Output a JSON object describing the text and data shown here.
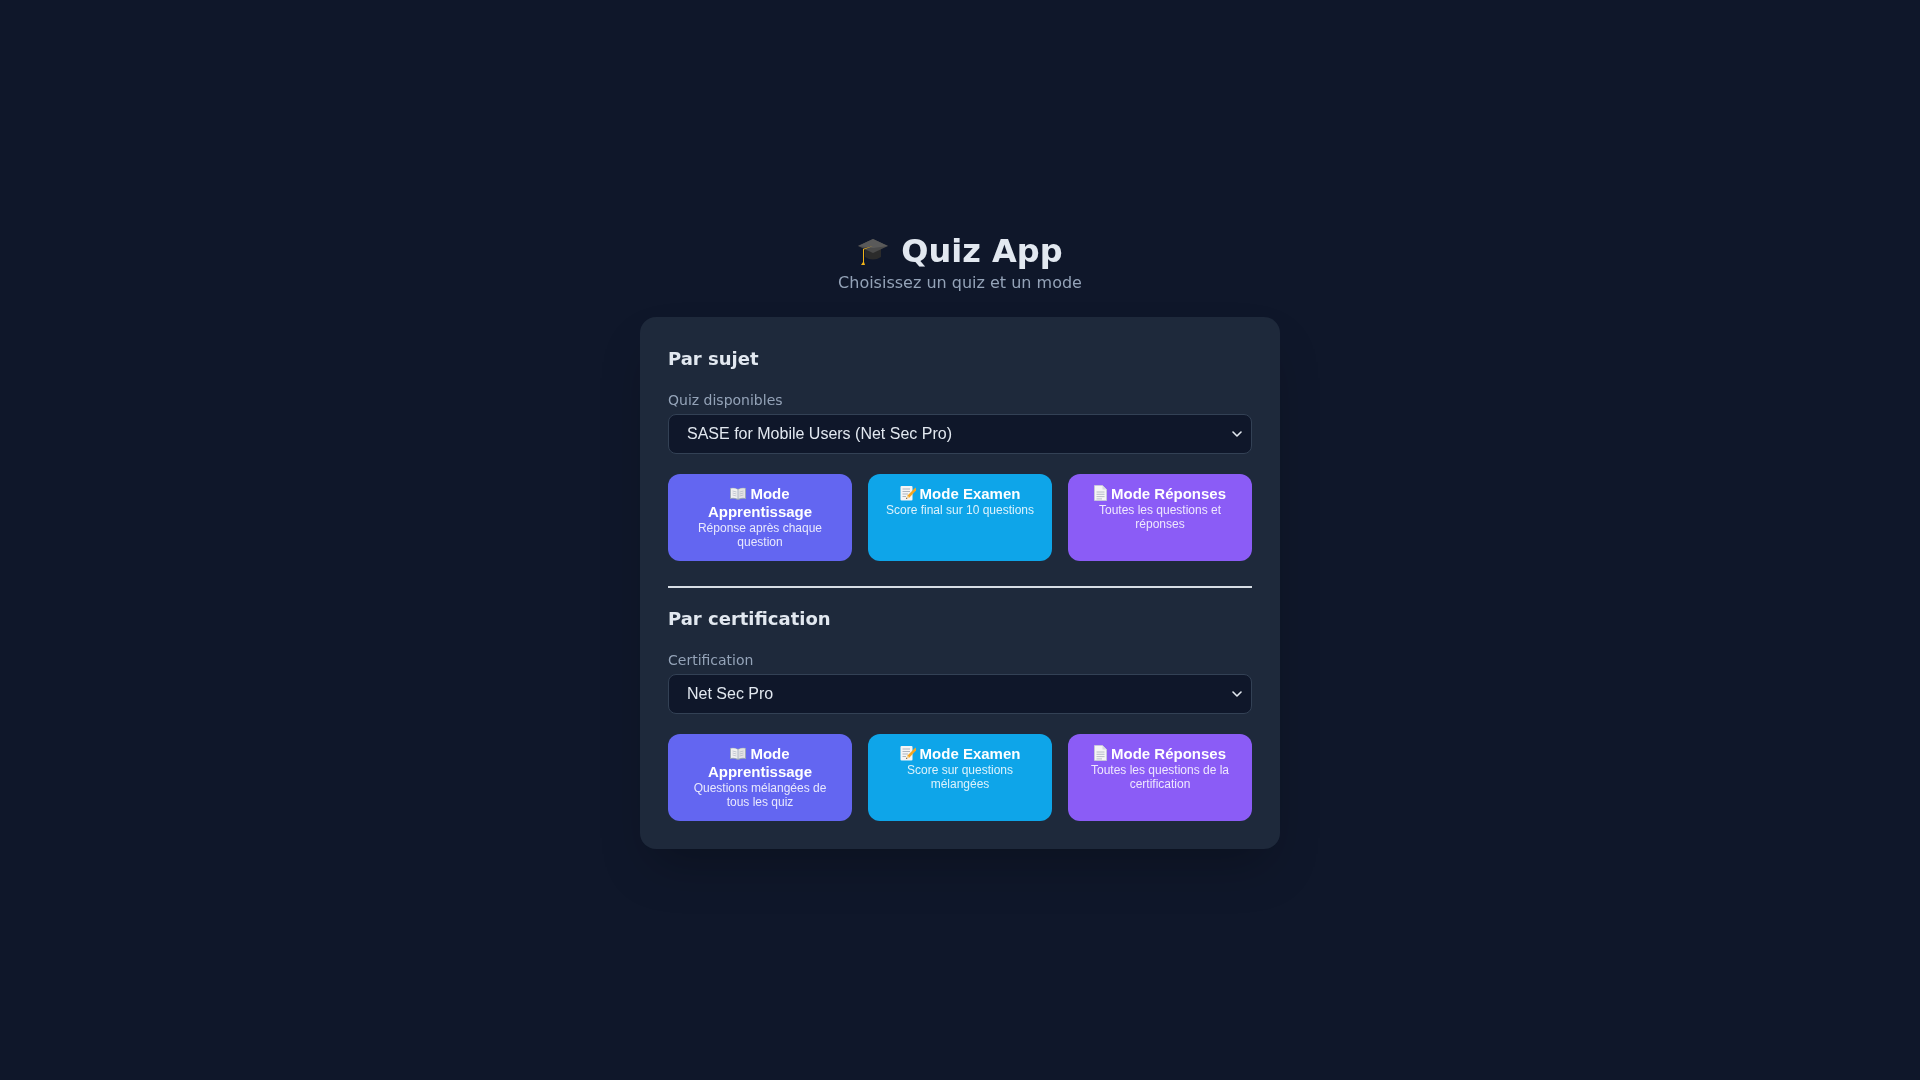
{
  "header": {
    "title": "Quiz App",
    "subtitle": "Choisissez un quiz et un mode"
  },
  "sections": [
    {
      "heading": "Par sujet",
      "field": {
        "label": "Quiz disponibles",
        "value": "SASE for Mobile Users (Net Sec Pro)"
      },
      "modes": [
        {
          "kind": "learn",
          "title": "Mode Apprentissage",
          "description": "Réponse après chaque question"
        },
        {
          "kind": "exam",
          "title": "Mode Examen",
          "description": "Score final sur 10 questions"
        },
        {
          "kind": "answers",
          "title": "Mode Réponses",
          "description": "Toutes les questions et réponses"
        }
      ]
    },
    {
      "heading": "Par certification",
      "field": {
        "label": "Certification",
        "value": "Net Sec Pro"
      },
      "modes": [
        {
          "kind": "learn",
          "title": "Mode Apprentissage",
          "description": "Questions mélangées de tous les quiz"
        },
        {
          "kind": "exam",
          "title": "Mode Examen",
          "description": "Score sur questions mélangées"
        },
        {
          "kind": "answers",
          "title": "Mode Réponses",
          "description": "Toutes les questions de la certification"
        }
      ]
    }
  ]
}
